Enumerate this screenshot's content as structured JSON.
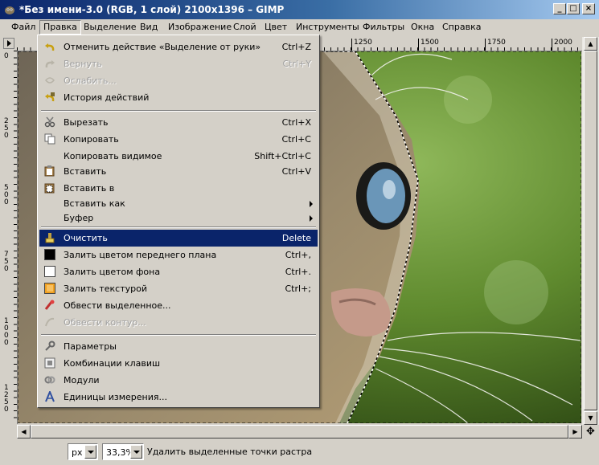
{
  "window": {
    "title": "*Без имени-3.0 (RGB, 1 слой) 2100x1396 – GIMP",
    "min_glyph": "_",
    "max_glyph": "□",
    "close_glyph": "×"
  },
  "menubar": {
    "items": [
      "Файл",
      "Правка",
      "Выделение",
      "Вид",
      "Изображение",
      "Слой",
      "Цвет",
      "Инструменты",
      "Фильтры",
      "Окна",
      "Справка"
    ],
    "active_index": 1
  },
  "ruler": {
    "h_labels": [
      "1250",
      "1500",
      "1750",
      "2000"
    ],
    "v_labels": [
      "0",
      "250",
      "500",
      "750",
      "1000",
      "1250"
    ]
  },
  "edit_menu": {
    "items": [
      {
        "label": "Отменить действие «Выделение от руки»",
        "shortcut": "Ctrl+Z",
        "icon": "undo-icon",
        "enabled": true
      },
      {
        "label": "Вернуть",
        "shortcut": "Ctrl+Y",
        "icon": "redo-icon",
        "enabled": false
      },
      {
        "label": "Ослабить...",
        "shortcut": "",
        "icon": "fade-icon",
        "enabled": false
      },
      {
        "label": "История действий",
        "shortcut": "",
        "icon": "undo-history-icon",
        "enabled": true
      },
      {
        "label": "Вырезать",
        "shortcut": "Ctrl+X",
        "icon": "cut-icon",
        "enabled": true
      },
      {
        "label": "Копировать",
        "shortcut": "Ctrl+C",
        "icon": "copy-icon",
        "enabled": true
      },
      {
        "label": "Копировать видимое",
        "shortcut": "Shift+Ctrl+C",
        "icon": "",
        "enabled": true
      },
      {
        "label": "Вставить",
        "shortcut": "Ctrl+V",
        "icon": "paste-icon",
        "enabled": true
      },
      {
        "label": "Вставить в",
        "shortcut": "",
        "icon": "paste-into-icon",
        "enabled": true
      },
      {
        "label": "Вставить как",
        "shortcut": "",
        "icon": "",
        "enabled": true,
        "submenu": true
      },
      {
        "label": "Буфер",
        "shortcut": "",
        "icon": "",
        "enabled": true,
        "submenu": true
      },
      {
        "label": "Очистить",
        "shortcut": "Delete",
        "icon": "clear-icon",
        "enabled": true,
        "highlighted": true
      },
      {
        "label": "Залить цветом переднего плана",
        "shortcut": "Ctrl+,",
        "icon": "fill-fg-icon",
        "enabled": true
      },
      {
        "label": "Залить цветом фона",
        "shortcut": "Ctrl+.",
        "icon": "fill-bg-icon",
        "enabled": true
      },
      {
        "label": "Залить текстурой",
        "shortcut": "Ctrl+;",
        "icon": "fill-pattern-icon",
        "enabled": true
      },
      {
        "label": "Обвести выделенное...",
        "shortcut": "",
        "icon": "stroke-selection-icon",
        "enabled": true
      },
      {
        "label": "Обвести контур...",
        "shortcut": "",
        "icon": "stroke-path-icon",
        "enabled": false
      },
      {
        "label": "Параметры",
        "shortcut": "",
        "icon": "preferences-icon",
        "enabled": true
      },
      {
        "label": "Комбинации клавиш",
        "shortcut": "",
        "icon": "keyboard-icon",
        "enabled": true
      },
      {
        "label": "Модули",
        "shortcut": "",
        "icon": "modules-icon",
        "enabled": true
      },
      {
        "label": "Единицы измерения...",
        "shortcut": "",
        "icon": "units-icon",
        "enabled": true
      }
    ]
  },
  "status": {
    "unit": "px",
    "zoom": "33,3%",
    "message": "Удалить выделенные точки растра"
  },
  "colors": {
    "titlebar_start": "#0a246a",
    "titlebar_end": "#a6caf0",
    "menu_bg": "#d4d0c8",
    "highlight": "#0a246a"
  }
}
